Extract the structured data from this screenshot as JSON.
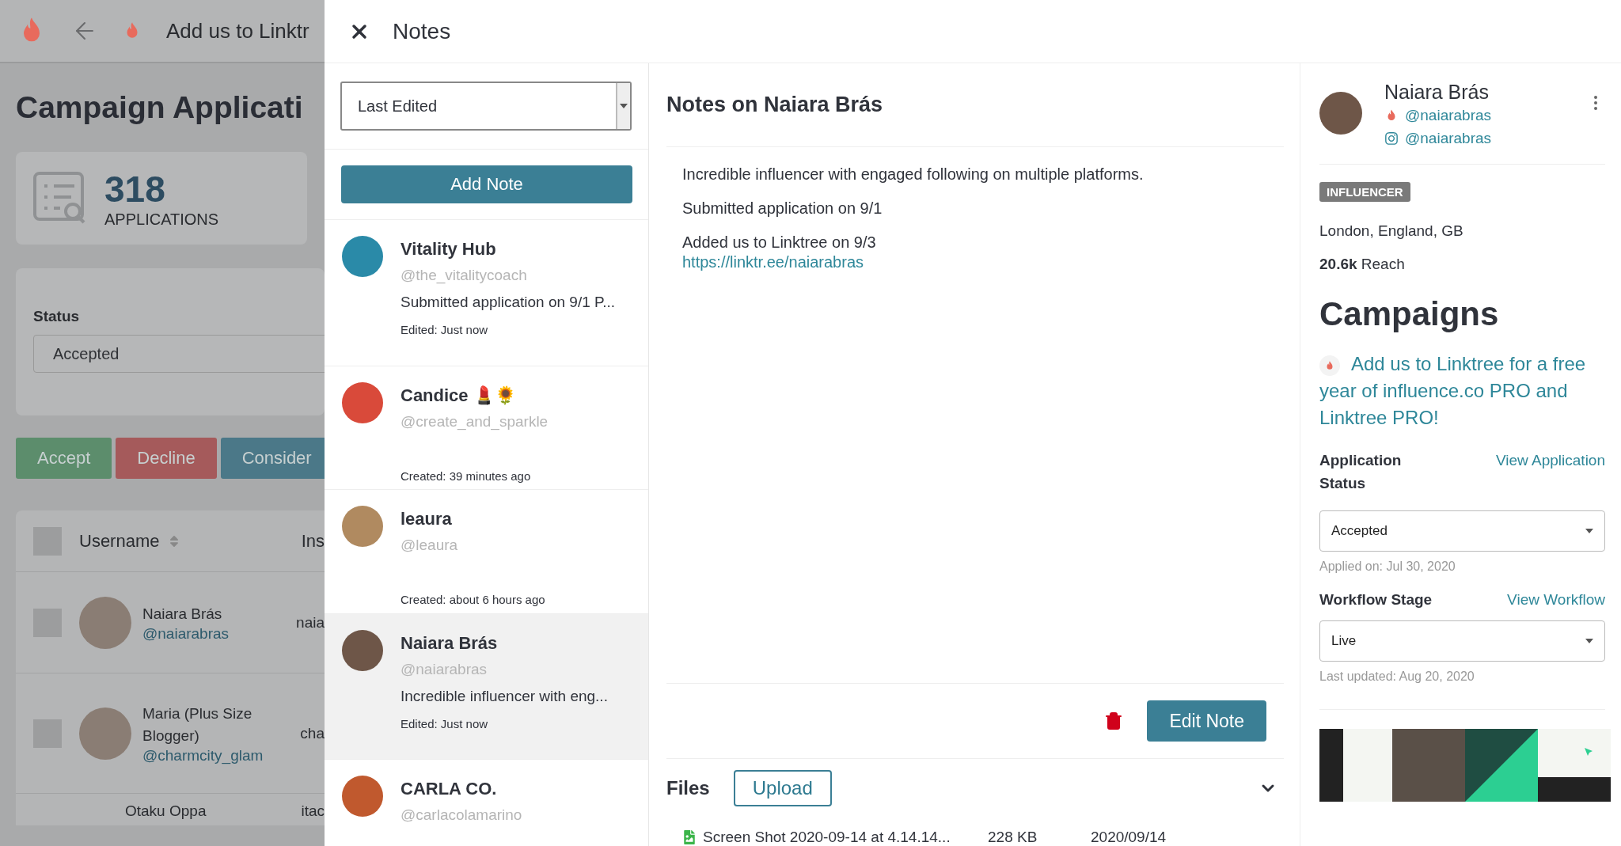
{
  "background_page": {
    "top_bar": {
      "title": "Add us to Linktr"
    },
    "heading": "Campaign Applicati",
    "stat": {
      "value": "318",
      "label": "APPLICATIONS"
    },
    "filter": {
      "label": "Status",
      "value": "Accepted"
    },
    "actions": [
      {
        "label": "Accept",
        "kind": "accept"
      },
      {
        "label": "Decline",
        "kind": "decline"
      },
      {
        "label": "Consider",
        "kind": "consider"
      }
    ],
    "table": {
      "header_checked": false,
      "columns": [
        "Username",
        "Ins"
      ],
      "rows": [
        {
          "name": "Naiara Brás",
          "handle": "@naiarabras",
          "column_2": "naia",
          "checked": false
        },
        {
          "name": "Maria (Plus Size Blogger)",
          "handle": "@charmcity_glam",
          "column_2": "cha",
          "checked": false
        },
        {
          "name": "Otaku Oppa",
          "column_2": "itac"
        }
      ]
    }
  },
  "drawer": {
    "title": "Notes",
    "sort": {
      "value": "Last Edited"
    },
    "add_button": "Add Note",
    "notes": [
      {
        "name": "Vitality Hub",
        "handle": "@the_vitalitycoach",
        "preview": "Submitted application on 9/1 P...",
        "meta": "Edited: Just now",
        "selected": false
      },
      {
        "name": "Candice 💄🌻",
        "handle": "@create_and_sparkle",
        "meta": "Created: 39 minutes ago",
        "selected": false
      },
      {
        "name": "leaura",
        "handle": "@leaura",
        "meta": "Created: about 6 hours ago",
        "selected": false
      },
      {
        "name": "Naiara Brás",
        "handle": "@naiarabras",
        "preview": "Incredible influencer with eng...",
        "meta": "Edited: Just now",
        "selected": true
      },
      {
        "name": "CARLA CO.",
        "handle": "@carlacolamarino",
        "selected": false
      }
    ],
    "note_detail": {
      "title": "Notes on Naiara Brás",
      "paragraphs": [
        {
          "text": "Incredible influencer with engaged following on multiple platforms."
        },
        {
          "text": "Submitted application on 9/1"
        },
        {
          "text": "Added us to Linktree on 9/3",
          "link": "https://linktr.ee/naiarabras"
        }
      ],
      "edit_button": "Edit Note",
      "files": {
        "title": "Files",
        "upload_button": "Upload",
        "items": [
          {
            "name": "Screen Shot 2020-09-14 at 4.14.14...",
            "size": "228 KB",
            "date": "2020/09/14"
          }
        ]
      }
    },
    "profile": {
      "name": "Naiara Brás",
      "handles": [
        {
          "kind": "flame",
          "handle": "@naiarabras"
        },
        {
          "kind": "instagram",
          "handle": "@naiarabras"
        }
      ],
      "tag": "INFLUENCER",
      "location": "London, England, GB",
      "reach": "**20.6k** Reach",
      "campaigns_heading": "Campaigns",
      "campaign": "Add us to Linktree for a free year of influence.co PRO and Linktree PRO!",
      "application": {
        "label": "Application Status",
        "link": "View Application",
        "value": "Accepted",
        "note": "Applied on: Jul 30, 2020"
      },
      "workflow": {
        "label": "Workflow Stage",
        "link": "View Workflow",
        "value": "Live",
        "note": "Last updated: Aug 20, 2020"
      }
    }
  }
}
